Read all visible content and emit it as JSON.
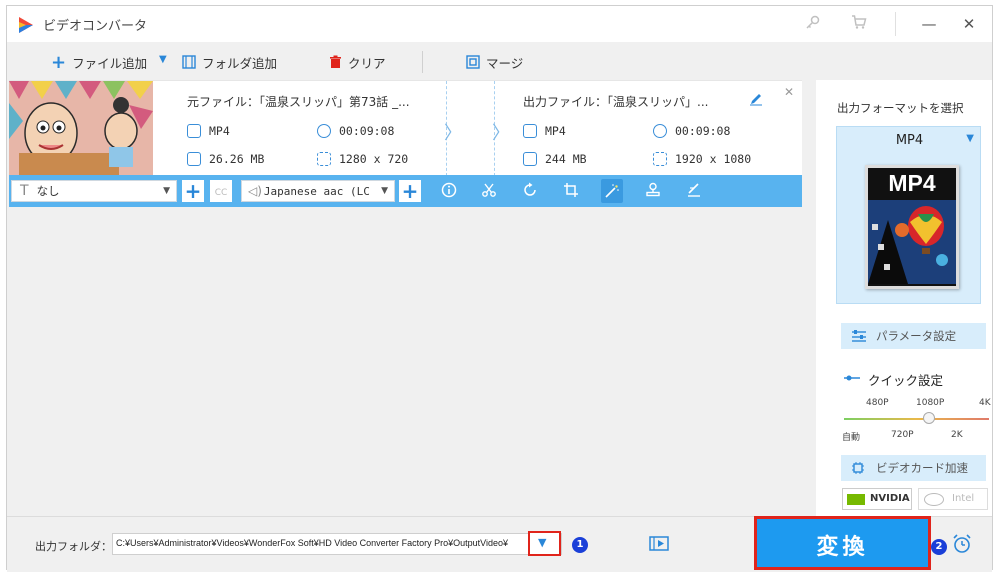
{
  "window": {
    "title": "ビデオコンバータ",
    "min_symbol": "—",
    "close_symbol": "✕"
  },
  "toolbar": {
    "add_file": "ファイル追加",
    "add_folder": "フォルダ追加",
    "clear": "クリア",
    "merge": "マージ"
  },
  "file": {
    "source_title": "元ファイル：「温泉スリッパ」第73話 _...",
    "source_format": "MP4",
    "source_duration": "00:09:08",
    "source_size": "26.26 MB",
    "source_resolution": "1280 x 720",
    "output_title": "出力ファイル：「温泉スリッパ」...",
    "output_format": "MP4",
    "output_duration": "00:09:08",
    "output_size": "244 MB",
    "output_resolution": "1920 x 1080",
    "close_symbol": "✕"
  },
  "editbar": {
    "subtitle": "なし",
    "cc": "CC",
    "audio": "Japanese aac (LC"
  },
  "panel": {
    "select_format": "出力フォーマットを選択",
    "format": "MP4",
    "format_badge": "MP4",
    "param_settings": "パラメータ設定",
    "quick_settings": "クイック設定",
    "slider_top": [
      "480P",
      "1080P",
      "4K"
    ],
    "slider_bottom": [
      "自動",
      "720P",
      "2K"
    ],
    "gpu_accel": "ビデオカード加速",
    "nvidia": "NVIDIA",
    "intel": "Intel"
  },
  "bottom": {
    "output_folder_label": "出力フォルダ：",
    "output_path": "C:¥Users¥Administrator¥Videos¥WonderFox Soft¥HD Video Converter Factory Pro¥OutputVideo¥",
    "convert": "変換",
    "badge1": "1",
    "badge2": "2"
  },
  "colors": {
    "accent": "#2a87d8",
    "bar": "#58b3ef",
    "convert_bg": "#1d9af0",
    "highlight": "#e0241b"
  }
}
